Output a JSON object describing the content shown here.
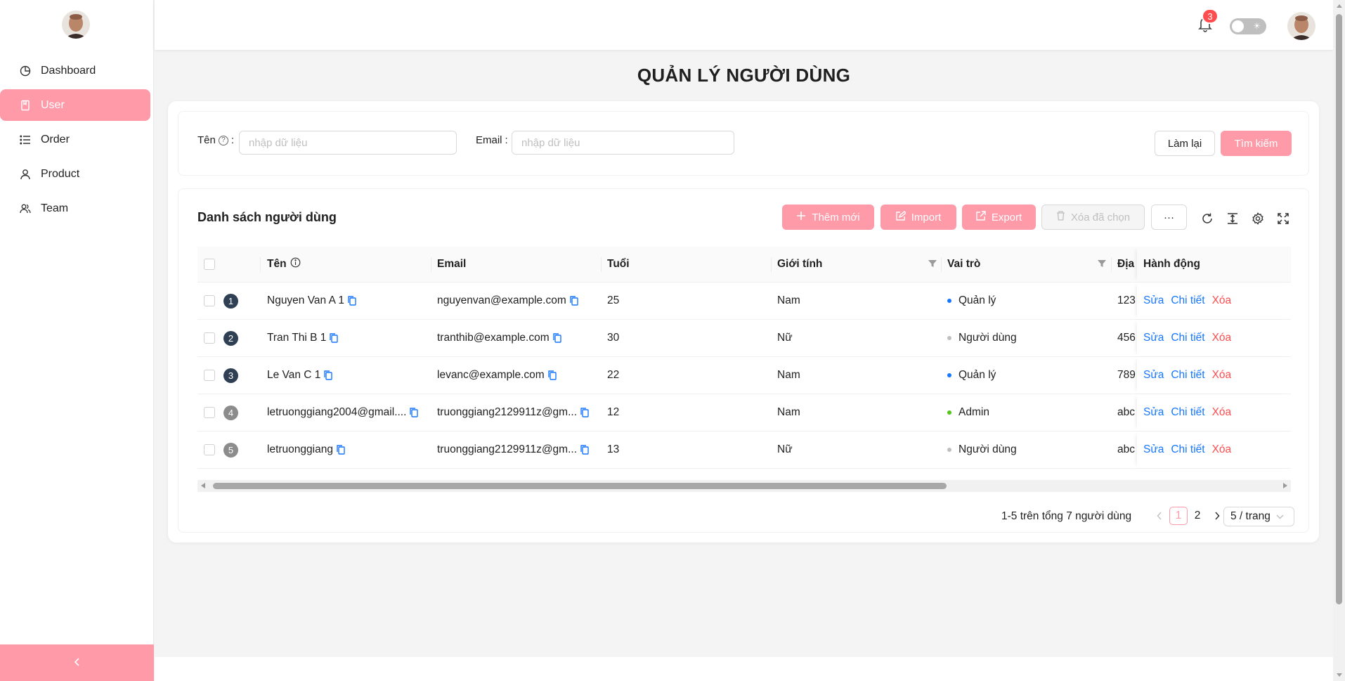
{
  "sidebar": {
    "items": [
      {
        "label": "Dashboard",
        "icon": "pie-chart-icon",
        "active": false
      },
      {
        "label": "User",
        "icon": "file-icon",
        "active": true
      },
      {
        "label": "Order",
        "icon": "list-icon",
        "active": false
      },
      {
        "label": "Product",
        "icon": "user-icon",
        "active": false
      },
      {
        "label": "Team",
        "icon": "team-icon",
        "active": false
      }
    ],
    "collapse_icon": "chevron-left-icon"
  },
  "header": {
    "notification_count": "3",
    "theme_toggle": "off"
  },
  "page": {
    "title": "QUẢN LÝ NGƯỜI DÙNG"
  },
  "search": {
    "name_label": "Tên",
    "name_placeholder": "nhập dữ liệu",
    "email_label": "Email",
    "email_placeholder": "nhập dữ liệu",
    "reset_label": "Làm lại",
    "search_label": "Tìm kiếm"
  },
  "table": {
    "title": "Danh sách người dùng",
    "toolbar": {
      "add_label": "Thêm mới",
      "import_label": "Import",
      "export_label": "Export",
      "delete_selected_label": "Xóa đã chọn",
      "more_label": "···"
    },
    "columns": {
      "name": "Tên",
      "email": "Email",
      "age": "Tuổi",
      "gender": "Giới tính",
      "role": "Vai trò",
      "address": "Địa",
      "action": "Hành động"
    },
    "rows": [
      {
        "index": "1",
        "name": "Nguyen Van A 1",
        "email": "nguyenvan@example.com",
        "age": "25",
        "gender": "Nam",
        "role": "Quản lý",
        "role_color": "#1677ff",
        "address": "123",
        "edit": "Sửa",
        "detail": "Chi tiết",
        "delete": "Xóa"
      },
      {
        "index": "2",
        "name": "Tran Thi B 1",
        "email": "tranthib@example.com",
        "age": "30",
        "gender": "Nữ",
        "role": "Người dùng",
        "role_color": "#bfbfbf",
        "address": "456",
        "edit": "Sửa",
        "detail": "Chi tiết",
        "delete": "Xóa"
      },
      {
        "index": "3",
        "name": "Le Van C 1",
        "email": "levanc@example.com",
        "age": "22",
        "gender": "Nam",
        "role": "Quản lý",
        "role_color": "#1677ff",
        "address": "789",
        "edit": "Sửa",
        "detail": "Chi tiết",
        "delete": "Xóa"
      },
      {
        "index": "4",
        "name": "letruonggiang2004@gmail....",
        "email": "truonggiang2129911z@gm...",
        "age": "12",
        "gender": "Nam",
        "role": "Admin",
        "role_color": "#52c41a",
        "address": "abc",
        "edit": "Sửa",
        "detail": "Chi tiết",
        "delete": "Xóa"
      },
      {
        "index": "5",
        "name": "letruonggiang",
        "email": "truonggiang2129911z@gm...",
        "age": "13",
        "gender": "Nữ",
        "role": "Người dùng",
        "role_color": "#bfbfbf",
        "address": "abc",
        "edit": "Sửa",
        "detail": "Chi tiết",
        "delete": "Xóa"
      }
    ]
  },
  "pagination": {
    "total_text": "1-5 trên tổng 7 người dùng",
    "pages": [
      "1",
      "2"
    ],
    "current": "1",
    "page_size": "5 / trang"
  },
  "colors": {
    "accent": "#ff9aa8",
    "link": "#1677ff",
    "danger": "#ff4d4f"
  }
}
